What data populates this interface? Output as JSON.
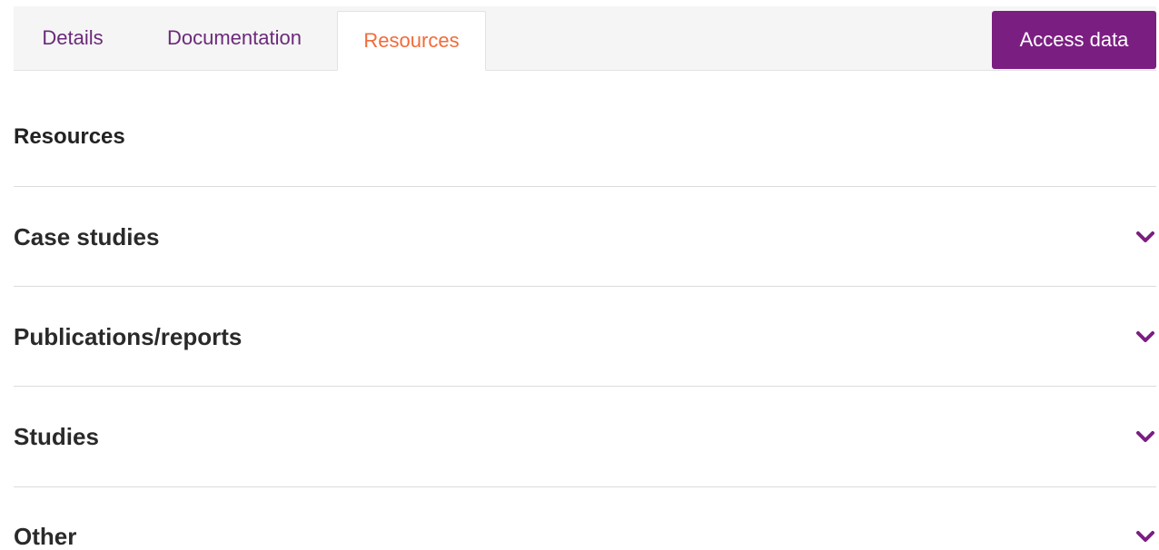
{
  "tabs": [
    {
      "label": "Details",
      "active": false
    },
    {
      "label": "Documentation",
      "active": false
    },
    {
      "label": "Resources",
      "active": true
    }
  ],
  "access_button": {
    "label": "Access data"
  },
  "section": {
    "title": "Resources"
  },
  "accordion": [
    {
      "label": "Case studies",
      "icon": "chevron-down-icon"
    },
    {
      "label": "Publications/reports",
      "icon": "chevron-down-icon"
    },
    {
      "label": "Studies",
      "icon": "chevron-down-icon"
    },
    {
      "label": "Other",
      "icon": "chevron-down-icon"
    }
  ],
  "colors": {
    "accent": "#7b1e82",
    "tab_text": "#6b2a7a",
    "active_tab_text": "#f26b3a",
    "tabbar_bg": "#f5f5f5"
  }
}
